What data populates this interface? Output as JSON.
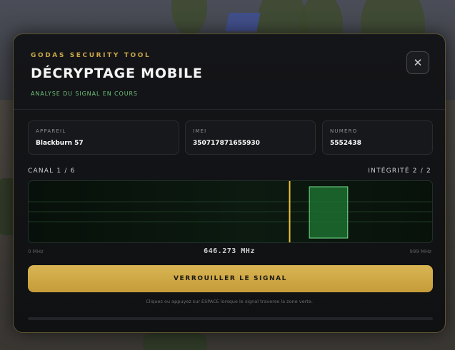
{
  "header": {
    "kicker": "GODAS SECURITY TOOL",
    "title": "DÉCRYPTAGE MOBILE",
    "subtitle": "ANALYSE DU SIGNAL EN COURS",
    "close_symbol": "✕",
    "close_icon": "close-icon"
  },
  "device": {
    "appareil_label": "APPAREIL",
    "appareil_value": "Blackburn 57",
    "imei_label": "IMEI",
    "imei_value": "350717871655930",
    "numero_label": "NUMÉRO",
    "numero_value": "5552438"
  },
  "signal": {
    "channel_label": "CANAL 1 / 6",
    "integrity_label": "INTÉGRITÉ 2 / 2",
    "min_label": "0 MHz",
    "max_label": "999 MHz",
    "min_mhz": 0,
    "max_mhz": 999,
    "frequency_text": "646.273 MHz",
    "cursor_mhz": 646.273,
    "target_zone_mhz": [
      695,
      790
    ]
  },
  "actions": {
    "lock_label": "VERROUILLER LE SIGNAL",
    "hint": "Cliquez ou appuyez sur ESPACE lorsque le signal traverse la zone verte."
  },
  "colors": {
    "accent_gold": "#c9a646",
    "signal_green": "#6ec07c",
    "cursor_yellow": "#f2c232"
  }
}
